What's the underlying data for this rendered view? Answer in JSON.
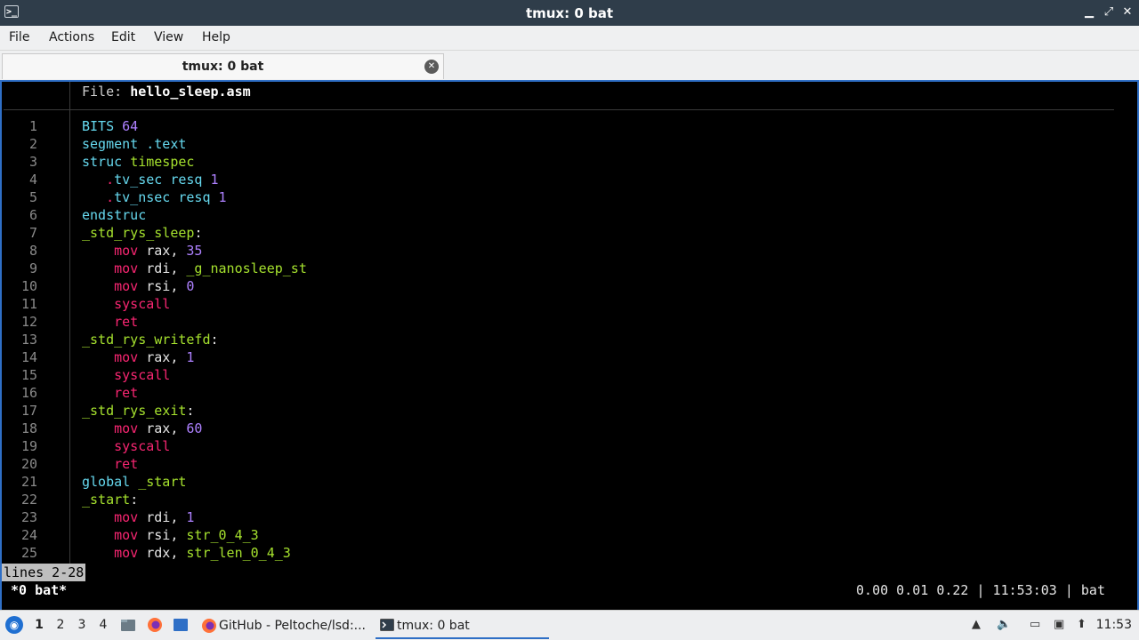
{
  "window": {
    "title": "tmux: 0 bat",
    "minimize": "▁",
    "maximize": "⤢",
    "close": "✕"
  },
  "menu": [
    "File",
    "Actions",
    "Edit",
    "View",
    "Help"
  ],
  "tab": {
    "label": "tmux: 0 bat"
  },
  "terminal": {
    "file_prefix": "File: ",
    "file_name": "hello_sleep.asm",
    "lines": [
      {
        "n": "1",
        "parts": [
          [
            "dir",
            "BITS "
          ],
          [
            "num",
            "64"
          ]
        ]
      },
      {
        "n": "2",
        "parts": [
          [
            "dir",
            "segment .text"
          ]
        ]
      },
      {
        "n": "3",
        "parts": [
          [
            "dir",
            "struc "
          ],
          [
            "type",
            "timespec"
          ]
        ]
      },
      {
        "n": "4",
        "parts": [
          [
            "punc",
            "   "
          ],
          [
            "dot",
            "."
          ],
          [
            "dir",
            "tv_sec resq "
          ],
          [
            "num",
            "1"
          ]
        ]
      },
      {
        "n": "5",
        "parts": [
          [
            "punc",
            "   "
          ],
          [
            "dot",
            "."
          ],
          [
            "dir",
            "tv_nsec resq "
          ],
          [
            "num",
            "1"
          ]
        ]
      },
      {
        "n": "6",
        "parts": [
          [
            "dir",
            "endstruc"
          ]
        ]
      },
      {
        "n": "7",
        "parts": [
          [
            "type",
            "_std_rys_sleep"
          ],
          [
            "punc",
            ":"
          ]
        ]
      },
      {
        "n": "8",
        "parts": [
          [
            "punc",
            "    "
          ],
          [
            "red",
            "mov"
          ],
          [
            "reg",
            " rax, "
          ],
          [
            "num",
            "35"
          ]
        ]
      },
      {
        "n": "9",
        "parts": [
          [
            "punc",
            "    "
          ],
          [
            "red",
            "mov"
          ],
          [
            "reg",
            " rdi, "
          ],
          [
            "type",
            "_g_nanosleep_st"
          ]
        ]
      },
      {
        "n": "10",
        "parts": [
          [
            "punc",
            "    "
          ],
          [
            "red",
            "mov"
          ],
          [
            "reg",
            " rsi, "
          ],
          [
            "num",
            "0"
          ]
        ]
      },
      {
        "n": "11",
        "parts": [
          [
            "punc",
            "    "
          ],
          [
            "red",
            "syscall"
          ]
        ]
      },
      {
        "n": "12",
        "parts": [
          [
            "punc",
            "    "
          ],
          [
            "red",
            "ret"
          ]
        ]
      },
      {
        "n": "13",
        "parts": [
          [
            "type",
            "_std_rys_writefd"
          ],
          [
            "punc",
            ":"
          ]
        ]
      },
      {
        "n": "14",
        "parts": [
          [
            "punc",
            "    "
          ],
          [
            "red",
            "mov"
          ],
          [
            "reg",
            " rax, "
          ],
          [
            "num",
            "1"
          ]
        ]
      },
      {
        "n": "15",
        "parts": [
          [
            "punc",
            "    "
          ],
          [
            "red",
            "syscall"
          ]
        ]
      },
      {
        "n": "16",
        "parts": [
          [
            "punc",
            "    "
          ],
          [
            "red",
            "ret"
          ]
        ]
      },
      {
        "n": "17",
        "parts": [
          [
            "type",
            "_std_rys_exit"
          ],
          [
            "punc",
            ":"
          ]
        ]
      },
      {
        "n": "18",
        "parts": [
          [
            "punc",
            "    "
          ],
          [
            "red",
            "mov"
          ],
          [
            "reg",
            " rax, "
          ],
          [
            "num",
            "60"
          ]
        ]
      },
      {
        "n": "19",
        "parts": [
          [
            "punc",
            "    "
          ],
          [
            "red",
            "syscall"
          ]
        ]
      },
      {
        "n": "20",
        "parts": [
          [
            "punc",
            "    "
          ],
          [
            "red",
            "ret"
          ]
        ]
      },
      {
        "n": "21",
        "parts": [
          [
            "dir",
            "global "
          ],
          [
            "type",
            "_start"
          ]
        ]
      },
      {
        "n": "22",
        "parts": [
          [
            "type",
            "_start"
          ],
          [
            "punc",
            ":"
          ]
        ]
      },
      {
        "n": "23",
        "parts": [
          [
            "punc",
            "    "
          ],
          [
            "red",
            "mov"
          ],
          [
            "reg",
            " rdi, "
          ],
          [
            "num",
            "1"
          ]
        ]
      },
      {
        "n": "24",
        "parts": [
          [
            "punc",
            "    "
          ],
          [
            "red",
            "mov"
          ],
          [
            "reg",
            " rsi, "
          ],
          [
            "type",
            "str_0_4_3"
          ]
        ]
      },
      {
        "n": "25",
        "parts": [
          [
            "punc",
            "    "
          ],
          [
            "red",
            "mov"
          ],
          [
            "reg",
            " rdx, "
          ],
          [
            "type",
            "str_len_0_4_3"
          ]
        ]
      }
    ],
    "pager": "lines 2-28",
    "status_left": "*0 bat*",
    "status_right": "0.00 0.01 0.22 | 11:53:03 | bat"
  },
  "taskbar": {
    "start_icon": "lubuntu-start-icon",
    "workspaces": [
      "1",
      "2",
      "3",
      "4"
    ],
    "active_workspace": "1",
    "tasks": [
      {
        "label": "GitHub - Peltoche/lsd:...",
        "icon": "firefox-icon"
      },
      {
        "label": "tmux: 0 bat",
        "icon": "terminal-icon"
      }
    ],
    "clock": "11:53"
  },
  "colors": {
    "titlebar": "#2f3d4a",
    "accent": "#2f6fc6",
    "directive": "#66d9ef",
    "label": "#a6e22e",
    "number": "#ae81ff",
    "keyword": "#f92672"
  }
}
